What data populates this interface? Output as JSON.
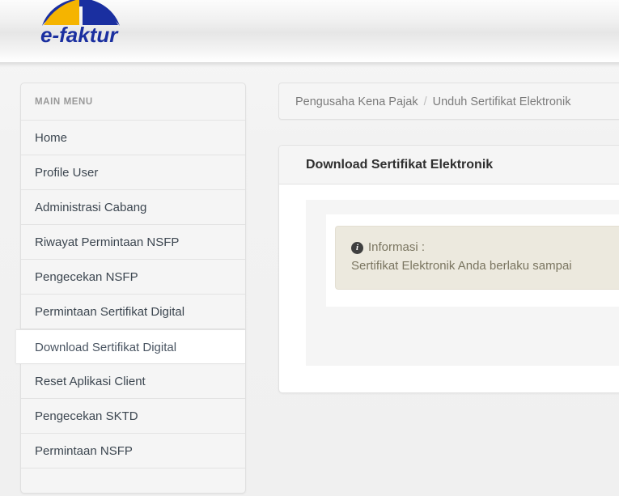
{
  "header": {
    "logo_text": "e-faktur",
    "logo_colors": {
      "yellow": "#f5b400",
      "blue": "#1a2fa0"
    }
  },
  "sidebar": {
    "title": "MAIN MENU",
    "items": [
      {
        "label": "Home",
        "active": false
      },
      {
        "label": "Profile User",
        "active": false
      },
      {
        "label": "Administrasi Cabang",
        "active": false
      },
      {
        "label": "Riwayat Permintaan NSFP",
        "active": false
      },
      {
        "label": "Pengecekan NSFP",
        "active": false
      },
      {
        "label": "Permintaan Sertifikat Digital",
        "active": false
      },
      {
        "label": "Download Sertifikat Digital",
        "active": true
      },
      {
        "label": "Reset Aplikasi Client",
        "active": false
      },
      {
        "label": "Pengecekan SKTD",
        "active": false
      },
      {
        "label": "Permintaan NSFP",
        "active": false
      }
    ]
  },
  "breadcrumb": {
    "items": [
      "Pengusaha Kena Pajak",
      "Unduh Sertifikat Elektronik"
    ],
    "separator": "/"
  },
  "panel": {
    "heading": "Download Sertifikat Elektronik",
    "alert": {
      "icon": "info-circle-icon",
      "title": "Informasi :",
      "message": "Sertifikat Elektronik Anda berlaku sampai",
      "background": "#ece9de",
      "text_color": "#7a7560"
    }
  }
}
